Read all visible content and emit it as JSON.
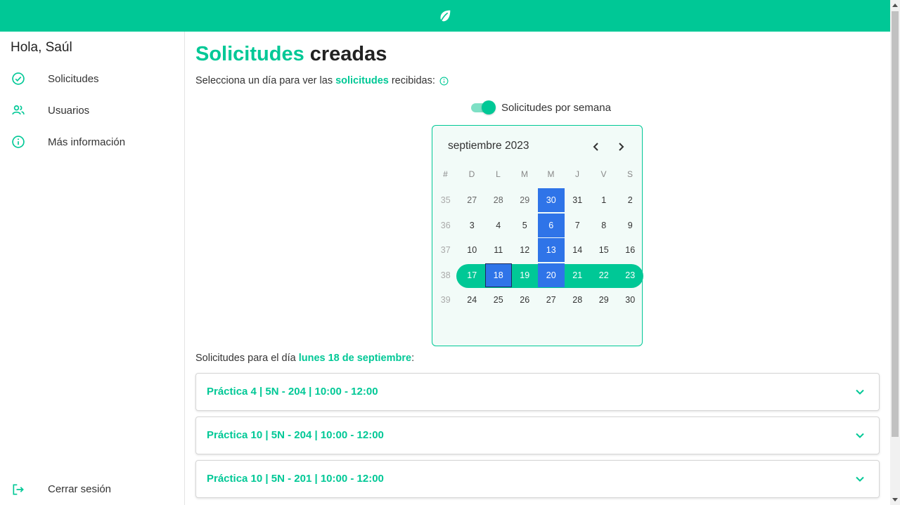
{
  "topbar": {
    "logo_icon": "leaf-icon",
    "color": "#00c896"
  },
  "sidebar": {
    "greeting": "Hola, Saúl",
    "items": [
      {
        "label": "Solicitudes",
        "icon": "check-circle-icon"
      },
      {
        "label": "Usuarios",
        "icon": "users-icon"
      },
      {
        "label": "Más información",
        "icon": "info-icon"
      }
    ],
    "logout": {
      "label": "Cerrar sesión",
      "icon": "logout-icon"
    }
  },
  "main": {
    "title_accent": "Solicitudes",
    "title_rest": "creadas",
    "subtitle_pre": "Selecciona un día para ver las",
    "subtitle_accent": "solicitudes",
    "subtitle_post": "recibidas:",
    "toggle": {
      "label": "Solicitudes por semana",
      "on": true
    },
    "calendar": {
      "month_label": "septiembre 2023",
      "weekday_headers": [
        "#",
        "D",
        "L",
        "M",
        "M",
        "J",
        "V",
        "S"
      ],
      "rows": [
        {
          "week": "35",
          "days": [
            "27",
            "28",
            "29",
            "30",
            "31",
            "1",
            "2"
          ]
        },
        {
          "week": "36",
          "days": [
            "3",
            "4",
            "5",
            "6",
            "7",
            "8",
            "9"
          ]
        },
        {
          "week": "37",
          "days": [
            "10",
            "11",
            "12",
            "13",
            "14",
            "15",
            "16"
          ]
        },
        {
          "week": "38",
          "days": [
            "17",
            "18",
            "19",
            "20",
            "21",
            "22",
            "23"
          ]
        },
        {
          "week": "39",
          "days": [
            "24",
            "25",
            "26",
            "27",
            "28",
            "29",
            "30"
          ]
        }
      ],
      "selected_day": "18",
      "highlight_column": "Miércoles",
      "selected_week": "38"
    },
    "day_label_pre": "Solicitudes para el día",
    "day_label_accent": "lunes 18 de septiembre",
    "day_label_post": ":",
    "requests": [
      {
        "title": "Práctica 4 | 5N - 204 | 10:00 - 12:00"
      },
      {
        "title": "Práctica 10 | 5N - 204 | 10:00 - 12:00"
      },
      {
        "title": "Práctica 10 | 5N - 201 | 10:00 - 12:00"
      }
    ]
  },
  "colors": {
    "accent": "#00c896",
    "highlight": "#2f74e8"
  }
}
